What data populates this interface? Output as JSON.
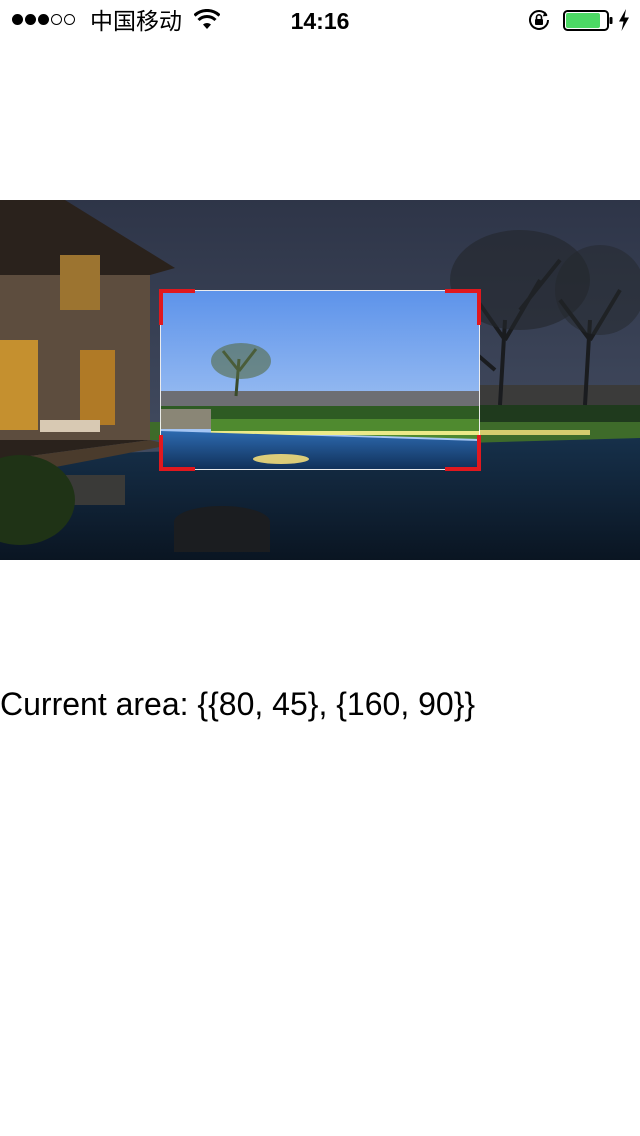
{
  "status_bar": {
    "signal_bars_filled": 3,
    "signal_bars_total": 5,
    "carrier": "中国移动",
    "time": "14:16",
    "icons": [
      "signal-dots-icon",
      "wifi-icon",
      "orientation-lock-icon",
      "battery-icon",
      "charging-bolt-icon"
    ],
    "battery_level": 0.85,
    "battery_color": "#4cd964"
  },
  "crop": {
    "corner_color": "#e0181e",
    "frame_color": "#ffffff"
  },
  "area_label": "Current area: {{80, 45}, {160, 90}}"
}
